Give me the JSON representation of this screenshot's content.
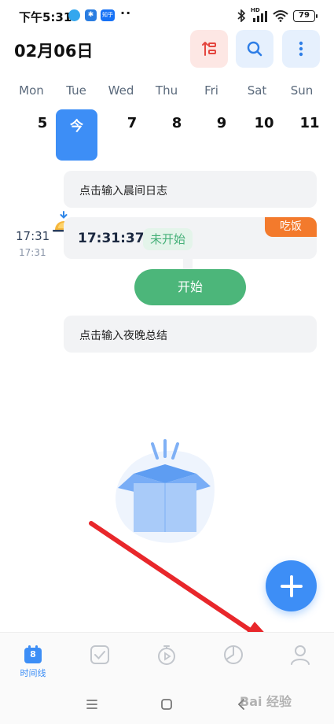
{
  "status_bar": {
    "time": "下午5:31",
    "app_icons": [
      "app-circle-icon",
      "bluetooth-app-icon",
      "zhihu-app-icon"
    ],
    "app_icon_text": [
      "",
      "✱",
      "知乎"
    ],
    "dots": "··",
    "network_label": "HD",
    "battery": "79"
  },
  "header": {
    "date": "02月06日",
    "icons": [
      "sort-icon",
      "search-icon",
      "more-vertical-icon"
    ]
  },
  "week": {
    "days": [
      {
        "weekday": "Mon",
        "day": "5"
      },
      {
        "weekday": "Tue",
        "day": "今"
      },
      {
        "weekday": "Wed",
        "day": "7"
      },
      {
        "weekday": "Thu",
        "day": "8"
      },
      {
        "weekday": "Fri",
        "day": "9"
      },
      {
        "weekday": "Sat",
        "day": "10"
      },
      {
        "weekday": "Sun",
        "day": "11"
      }
    ],
    "selected_index": 1
  },
  "timeline": {
    "morning_log_placeholder": "点击输入晨间日志",
    "task": {
      "time_left": "17:31",
      "time_left_sub": "17:31",
      "time": "17:31:37",
      "status": "未开始",
      "category": "吃饭",
      "start_label": "开始"
    },
    "evening_summary_placeholder": "点击输入夜晚总结"
  },
  "fab": {
    "icon": "plus-icon"
  },
  "tab_bar": {
    "tabs": [
      {
        "icon": "calendar-icon",
        "label": "时间线",
        "badge": "8",
        "active": true
      },
      {
        "icon": "checkbox-icon",
        "label": "",
        "active": false
      },
      {
        "icon": "timer-icon",
        "label": "",
        "active": false
      },
      {
        "icon": "pie-chart-icon",
        "label": "",
        "active": false
      },
      {
        "icon": "profile-icon",
        "label": "",
        "active": false
      }
    ]
  },
  "nav_bar": {
    "buttons": [
      "menu-icon",
      "home-icon",
      "back-icon"
    ]
  },
  "watermark": "Bai 经验",
  "colors": {
    "accent": "#3d8ef6",
    "success": "#4cb67a",
    "tag_orange": "#f37a2c",
    "annotation_red": "#e8272b"
  }
}
